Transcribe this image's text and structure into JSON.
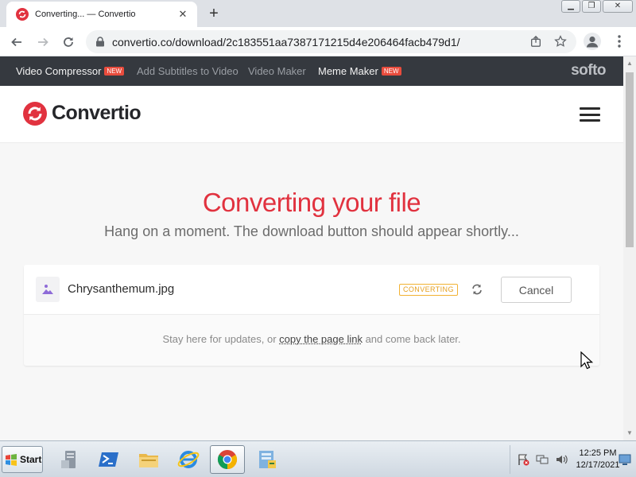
{
  "browser": {
    "tab_title": "Converting... — Convertio",
    "url": "convertio.co/download/2c183551aa7387171215d4e206464facb479d1/",
    "new_tab_symbol": "+",
    "tab_close_symbol": "✕",
    "window_minimize": "▁",
    "window_restore": "❐",
    "window_close": "✕"
  },
  "promo_bar": {
    "items": [
      {
        "label": "Video Compressor",
        "badge": "NEW"
      },
      {
        "label": "Add Subtitles to Video",
        "badge": ""
      },
      {
        "label": "Video Maker",
        "badge": ""
      },
      {
        "label": "Meme Maker",
        "badge": "NEW"
      }
    ],
    "brand": "softo"
  },
  "header": {
    "logo_text": "Convertio"
  },
  "main": {
    "headline": "Converting your file",
    "subline": "Hang on a moment. The download button should appear shortly...",
    "file": {
      "name": "Chrysanthemum.jpg",
      "status": "CONVERTING",
      "cancel_label": "Cancel"
    },
    "note_before": "Stay here for updates, or ",
    "note_link": "copy the page link",
    "note_after": " and come back later."
  },
  "taskbar": {
    "start_label": "Start",
    "time": "12:25 PM",
    "date": "12/17/2021"
  },
  "colors": {
    "accent_red": "#e1323f",
    "promo_bg": "#35393f",
    "badge_new": "#e94c3d",
    "status_converting": "#f2b233"
  },
  "icons": [
    "convertio-favicon",
    "back-arrow-icon",
    "forward-arrow-icon",
    "reload-icon",
    "lock-icon",
    "share-icon",
    "star-icon",
    "profile-icon",
    "more-vert-icon",
    "hamburger-icon",
    "image-file-icon",
    "refresh-icon",
    "mouse-cursor-icon",
    "windows-flag-icon",
    "server-manager-icon",
    "powershell-icon",
    "file-explorer-icon",
    "internet-explorer-icon",
    "chrome-icon",
    "network-folder-icon",
    "action-center-icon",
    "network-icon",
    "volume-icon",
    "show-desktop-icon"
  ]
}
